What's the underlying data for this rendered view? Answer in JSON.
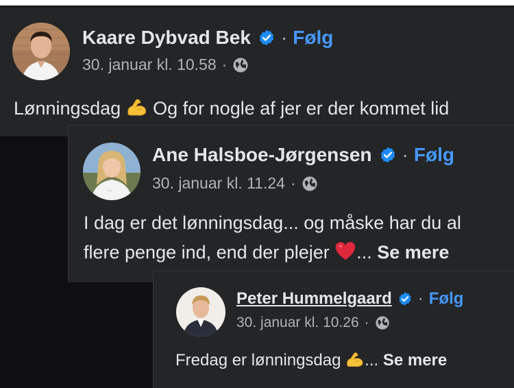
{
  "posts": [
    {
      "author": "Kaare Dybvad Bek",
      "follow_label": "Følg",
      "separator": "·",
      "timestamp": "30. januar kl. 10.58",
      "text_before_emoji": "Lønningsdag ",
      "text_after_emoji": " Og for nogle af jer er der kommet lid",
      "emoji": "flexed-biceps"
    },
    {
      "author": "Ane Halsboe-Jørgensen",
      "follow_label": "Følg",
      "separator": "·",
      "timestamp": "30. januar kl. 11.24",
      "text_line1": "I dag er det lønningsdag... og måske har du al",
      "text_line2_before_emoji": "flere penge ind, end der plejer ",
      "text_line2_after_emoji": "... ",
      "see_more": "Se mere",
      "emoji": "red-heart"
    },
    {
      "author": "Peter Hummelgaard",
      "follow_label": "Følg",
      "separator": "·",
      "timestamp": "30. januar kl. 10.26",
      "text_before_emoji": "Fredag er lønningsdag ",
      "text_after_emoji": "... ",
      "see_more": "Se mere",
      "emoji": "flexed-biceps"
    }
  ],
  "colors": {
    "card_bg": "#242526",
    "page_bg": "#0f0f12",
    "text_primary": "#e4e6eb",
    "text_secondary": "#b0b3b8",
    "link_blue": "#4599ff",
    "verified_blue": "#1d8cf8"
  },
  "icons": {
    "verified": "verified-badge-icon",
    "audience": "globe-icon"
  }
}
